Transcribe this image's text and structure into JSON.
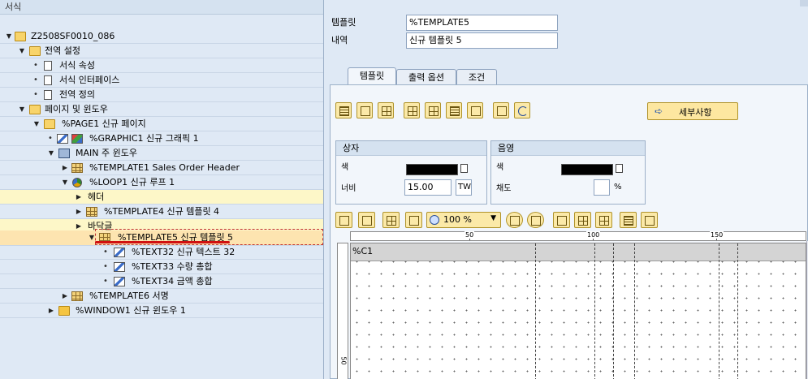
{
  "tree": {
    "header": "서식",
    "rows": [
      {
        "label": "Z2508SF0010_086",
        "toggle": "▼",
        "icon": "folder-open-icon"
      },
      {
        "label": "전역 설정",
        "toggle": "▼",
        "icon": "folder-open-icon"
      },
      {
        "label": "서식 속성",
        "icon": "document-icon"
      },
      {
        "label": "서식 인터페이스",
        "icon": "document-icon"
      },
      {
        "label": "전역 정의",
        "icon": "document-icon"
      },
      {
        "label": "페이지 및 윈도우",
        "toggle": "▼",
        "icon": "folder-open-icon"
      },
      {
        "label": "%PAGE1 신규 페이지",
        "toggle": "▼",
        "icon": "folder-open-icon"
      },
      {
        "label": "%GRAPHIC1 신규 그래픽 1",
        "icon": "graphic-icon"
      },
      {
        "label": "MAIN 주 윈도우",
        "toggle": "▼",
        "icon": "window-icon"
      },
      {
        "label": "%TEMPLATE1 Sales Order Header",
        "toggle": "▶",
        "icon": "table-icon"
      },
      {
        "label": "%LOOP1 신규 루프 1",
        "toggle": "▼",
        "icon": "loop-icon"
      },
      {
        "label": "헤더",
        "toggle": "▶"
      },
      {
        "label": "%TEMPLATE4 신규 템플릿 4",
        "toggle": "▶",
        "icon": "table-icon"
      },
      {
        "label": "바닥글",
        "toggle": "▶"
      },
      {
        "label": "%TEMPLATE5 신규 템플릿 5",
        "toggle": "▼",
        "icon": "table-icon"
      },
      {
        "label": "%TEXT32 신규 텍스트 32",
        "icon": "text-icon"
      },
      {
        "label": "%TEXT33 수량 총합",
        "icon": "text-icon"
      },
      {
        "label": "%TEXT34 금액 총합",
        "icon": "text-icon"
      },
      {
        "label": "%TEMPLATE6 서명",
        "toggle": "▶",
        "icon": "table-icon"
      },
      {
        "label": "%WINDOW1 신규 윈도우 1",
        "toggle": "▶",
        "icon": "folder-icon"
      }
    ]
  },
  "form": {
    "template_label": "템플릿",
    "template_value": "%TEMPLATE5",
    "desc_label": "내역",
    "desc_value": "신규 템플릿 5"
  },
  "tabs": [
    "템플릿",
    "출력 옵션",
    "조건"
  ],
  "detail_button": "세부사항",
  "box_group": {
    "title": "상자",
    "color_label": "색",
    "width_label": "너비",
    "width_value": "15.00",
    "width_unit": "TW"
  },
  "shade_group": {
    "title": "음영",
    "color_label": "색",
    "saturation_label": "채도",
    "saturation_value": "",
    "saturation_unit": "%"
  },
  "zoom": {
    "value": "100 %"
  },
  "ruler": {
    "mark_50": "50",
    "mark_100": "100",
    "mark_150": "150",
    "vmark_50": "50"
  },
  "canvas": {
    "cell_label": "%C1"
  }
}
